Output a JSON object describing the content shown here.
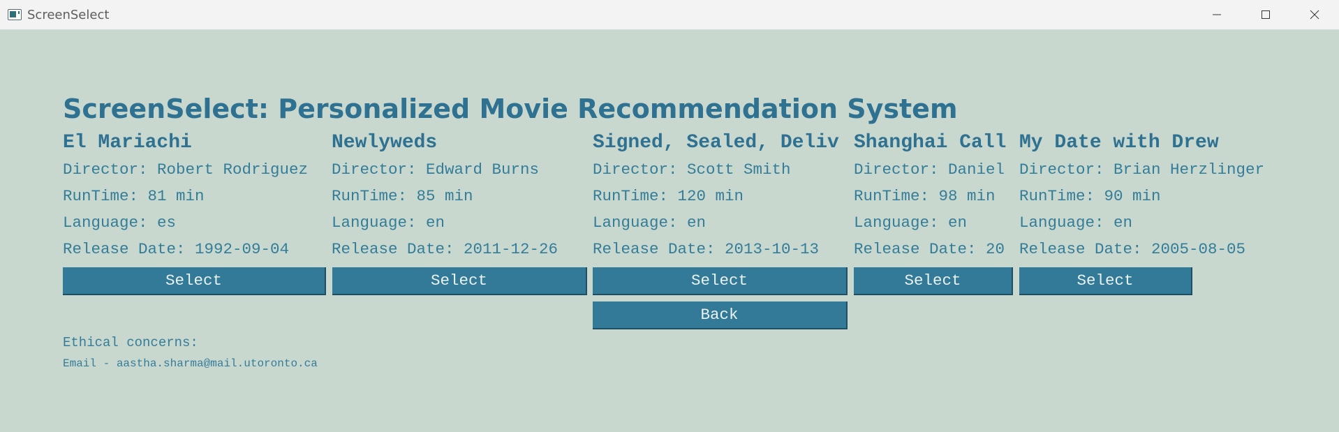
{
  "window": {
    "title": "ScreenSelect",
    "controls": [
      "minimize-icon",
      "maximize-icon",
      "close-icon"
    ]
  },
  "heading": "ScreenSelect: Personalized Movie Recommendation System",
  "movies": [
    {
      "title": "El Mariachi",
      "director": "Director: Robert Rodriguez",
      "runtime": "RunTime: 81 min",
      "language": "Language: es",
      "release": "Release Date: 1992-09-04",
      "select_label": "Select"
    },
    {
      "title": "Newlyweds",
      "director": "Director: Edward Burns",
      "runtime": "RunTime: 85 min",
      "language": "Language: en",
      "release": "Release Date: 2011-12-26",
      "select_label": "Select"
    },
    {
      "title": "Signed, Sealed, Deliv",
      "director": "Director: Scott Smith",
      "runtime": "RunTime: 120 min",
      "language": "Language: en",
      "release": "Release Date: 2013-10-13",
      "select_label": "Select"
    },
    {
      "title": "Shanghai Call",
      "director": "Director: Daniel",
      "runtime": "RunTime: 98 min",
      "language": "Language: en",
      "release": "Release Date: 20",
      "select_label": "Select"
    },
    {
      "title": "My Date with Drew",
      "director": "Director: Brian Herzlinger",
      "runtime": "RunTime: 90 min",
      "language": "Language: en",
      "release": "Release Date: 2005-08-05",
      "select_label": "Select"
    }
  ],
  "back_label": "Back",
  "footer": {
    "label": "Ethical concerns:",
    "email": "Email - aastha.sharma@mail.utoronto.ca"
  },
  "colors": {
    "background": "#c9d8cf",
    "accent": "#327a98",
    "text": "#347d99"
  }
}
